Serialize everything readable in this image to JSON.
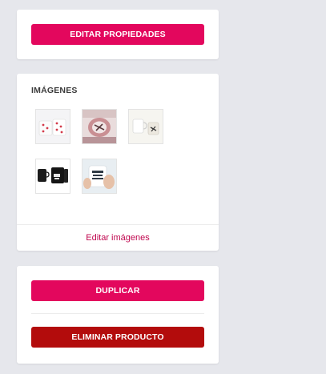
{
  "properties_card": {
    "edit_button_label": "EDITAR PROPIEDADES"
  },
  "images_card": {
    "title": "IMÁGENES",
    "thumbnails": [
      {
        "name": "image-thumbnail-1",
        "icon": "mug-hearts-icon"
      },
      {
        "name": "image-thumbnail-2",
        "icon": "mug-pink-icon"
      },
      {
        "name": "image-thumbnail-3",
        "icon": "mug-white-icon"
      },
      {
        "name": "image-thumbnail-4",
        "icon": "mug-black-icon"
      },
      {
        "name": "image-thumbnail-5",
        "icon": "mug-hand-icon"
      }
    ],
    "edit_link_label": "Editar imágenes"
  },
  "actions_card": {
    "duplicate_label": "DUPLICAR",
    "delete_label": "ELIMINAR PRODUCTO"
  },
  "colors": {
    "primary": "#e3075d",
    "danger": "#b30c0c",
    "link": "#c0074f",
    "background": "#e6e7ec"
  }
}
